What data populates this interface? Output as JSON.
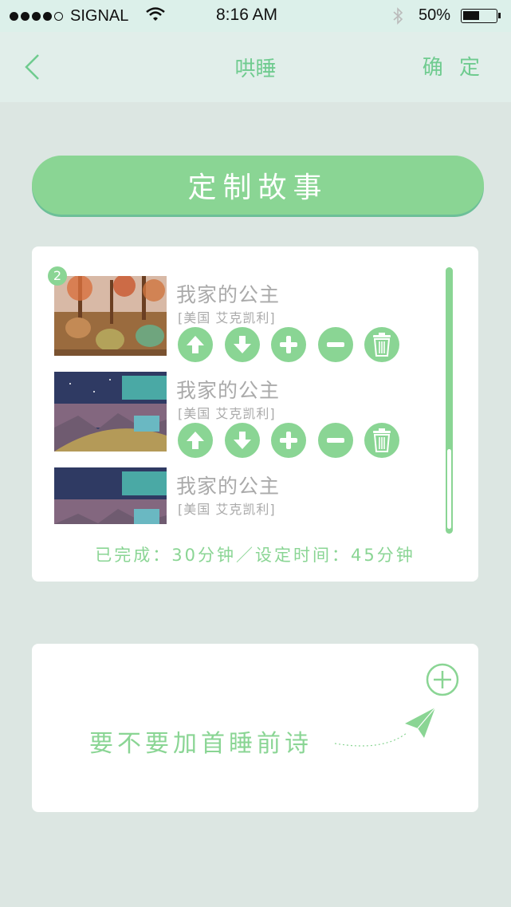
{
  "status_bar": {
    "carrier": "SIGNAL",
    "time": "8:16 AM",
    "battery": "50%"
  },
  "nav": {
    "title": "哄睡",
    "confirm": "确 定"
  },
  "custom_story": {
    "label": "定制故事"
  },
  "playlist": {
    "items": [
      {
        "badge": "2",
        "title": "我家的公主",
        "author": "[美国 艾克凯利]"
      },
      {
        "title": "我家的公主",
        "author": "[美国 艾克凯利]"
      },
      {
        "title": "我家的公主",
        "author": "[美国 艾克凯利]"
      }
    ],
    "progress": "已完成：30分钟／设定时间：45分钟"
  },
  "poem_card": {
    "text": "要不要加首睡前诗"
  },
  "colors": {
    "accent": "#8ad594",
    "background": "#dce6e2",
    "muted_text": "#aaaaaa"
  },
  "icons": [
    "back-chevron-icon",
    "move-up-icon",
    "move-down-icon",
    "plus-icon",
    "minus-icon",
    "trash-icon",
    "add-circle-icon",
    "paper-plane-icon",
    "wifi-icon",
    "bluetooth-icon",
    "battery-icon"
  ]
}
